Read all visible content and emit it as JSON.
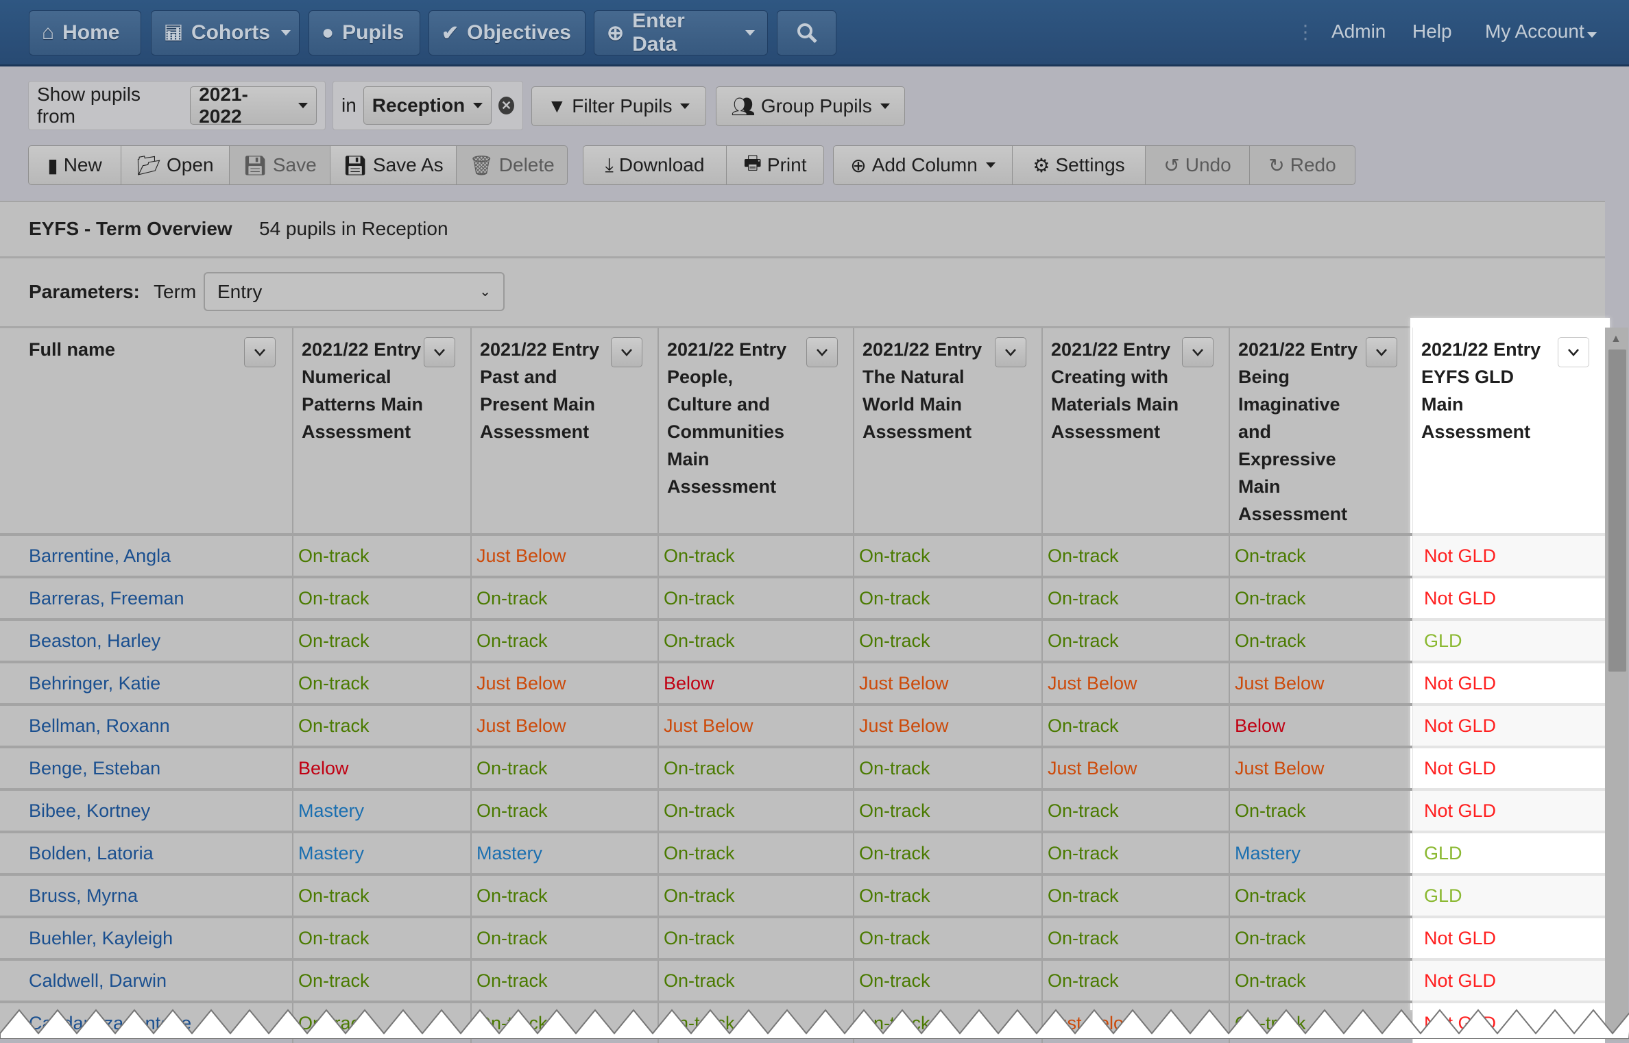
{
  "nav": {
    "home": "Home",
    "cohorts": "Cohorts",
    "pupils": "Pupils",
    "objectives": "Objectives",
    "enter_data": "Enter Data",
    "admin": "Admin",
    "help": "Help",
    "account": "My Account"
  },
  "filters": {
    "show_from_label": "Show pupils from",
    "year": "2021-2022",
    "in_label": "in",
    "group": "Reception",
    "filter_pupils": "Filter Pupils",
    "group_pupils": "Group Pupils"
  },
  "toolbar": {
    "new": "New",
    "open": "Open",
    "save": "Save",
    "save_as": "Save As",
    "delete": "Delete",
    "download": "Download",
    "print": "Print",
    "add_column": "Add Column",
    "settings": "Settings",
    "undo": "Undo",
    "redo": "Redo"
  },
  "report": {
    "title": "EYFS - Term Overview",
    "count": "54 pupils in Reception",
    "params_label": "Parameters:",
    "term_label": "Term",
    "term_value": "Entry"
  },
  "columns": [
    "Full name",
    "2021/22 Entry Numerical Patterns Main Assessment",
    "2021/22 Entry Past and Present Main Assessment",
    "2021/22 Entry People, Culture and Communities Main Assessment",
    "2021/22 Entry The Natural World Main Assessment",
    "2021/22 Entry Creating with Materials Main Assessment",
    "2021/22 Entry Being Imaginative and Expressive Main Assessment",
    "2021/22 Entry EYFS GLD Main Assessment"
  ],
  "rows": [
    [
      "Barrentine, Angla",
      "On-track",
      "Just Below",
      "On-track",
      "On-track",
      "On-track",
      "On-track",
      "Not GLD"
    ],
    [
      "Barreras, Freeman",
      "On-track",
      "On-track",
      "On-track",
      "On-track",
      "On-track",
      "On-track",
      "Not GLD"
    ],
    [
      "Beaston, Harley",
      "On-track",
      "On-track",
      "On-track",
      "On-track",
      "On-track",
      "On-track",
      "GLD"
    ],
    [
      "Behringer, Katie",
      "On-track",
      "Just Below",
      "Below",
      "Just Below",
      "Just Below",
      "Just Below",
      "Not GLD"
    ],
    [
      "Bellman, Roxann",
      "On-track",
      "Just Below",
      "Just Below",
      "Just Below",
      "On-track",
      "Below",
      "Not GLD"
    ],
    [
      "Benge, Esteban",
      "Below",
      "On-track",
      "On-track",
      "On-track",
      "Just Below",
      "Just Below",
      "Not GLD"
    ],
    [
      "Bibee, Kortney",
      "Mastery",
      "On-track",
      "On-track",
      "On-track",
      "On-track",
      "On-track",
      "Not GLD"
    ],
    [
      "Bolden, Latoria",
      "Mastery",
      "Mastery",
      "On-track",
      "On-track",
      "On-track",
      "Mastery",
      "GLD"
    ],
    [
      "Bruss, Myrna",
      "On-track",
      "On-track",
      "On-track",
      "On-track",
      "On-track",
      "On-track",
      "GLD"
    ],
    [
      "Buehler, Kayleigh",
      "On-track",
      "On-track",
      "On-track",
      "On-track",
      "On-track",
      "On-track",
      "Not GLD"
    ],
    [
      "Caldwell, Darwin",
      "On-track",
      "On-track",
      "On-track",
      "On-track",
      "On-track",
      "On-track",
      "Not GLD"
    ],
    [
      "Candanoza, Antone",
      "On-track",
      "On-track",
      "On-track",
      "On-track",
      "Just Below",
      "On-track",
      "Not GLD"
    ]
  ],
  "colors": {
    "name": "#1a4f8f",
    "On-track": "#4a7a00",
    "Just Below": "#cc4a0a",
    "Below": "#c00012",
    "Mastery": "#1a6fb0",
    "GLD": "#8ab830",
    "Not GLD": "#ff1f1f",
    "nav": "#2c5079"
  }
}
